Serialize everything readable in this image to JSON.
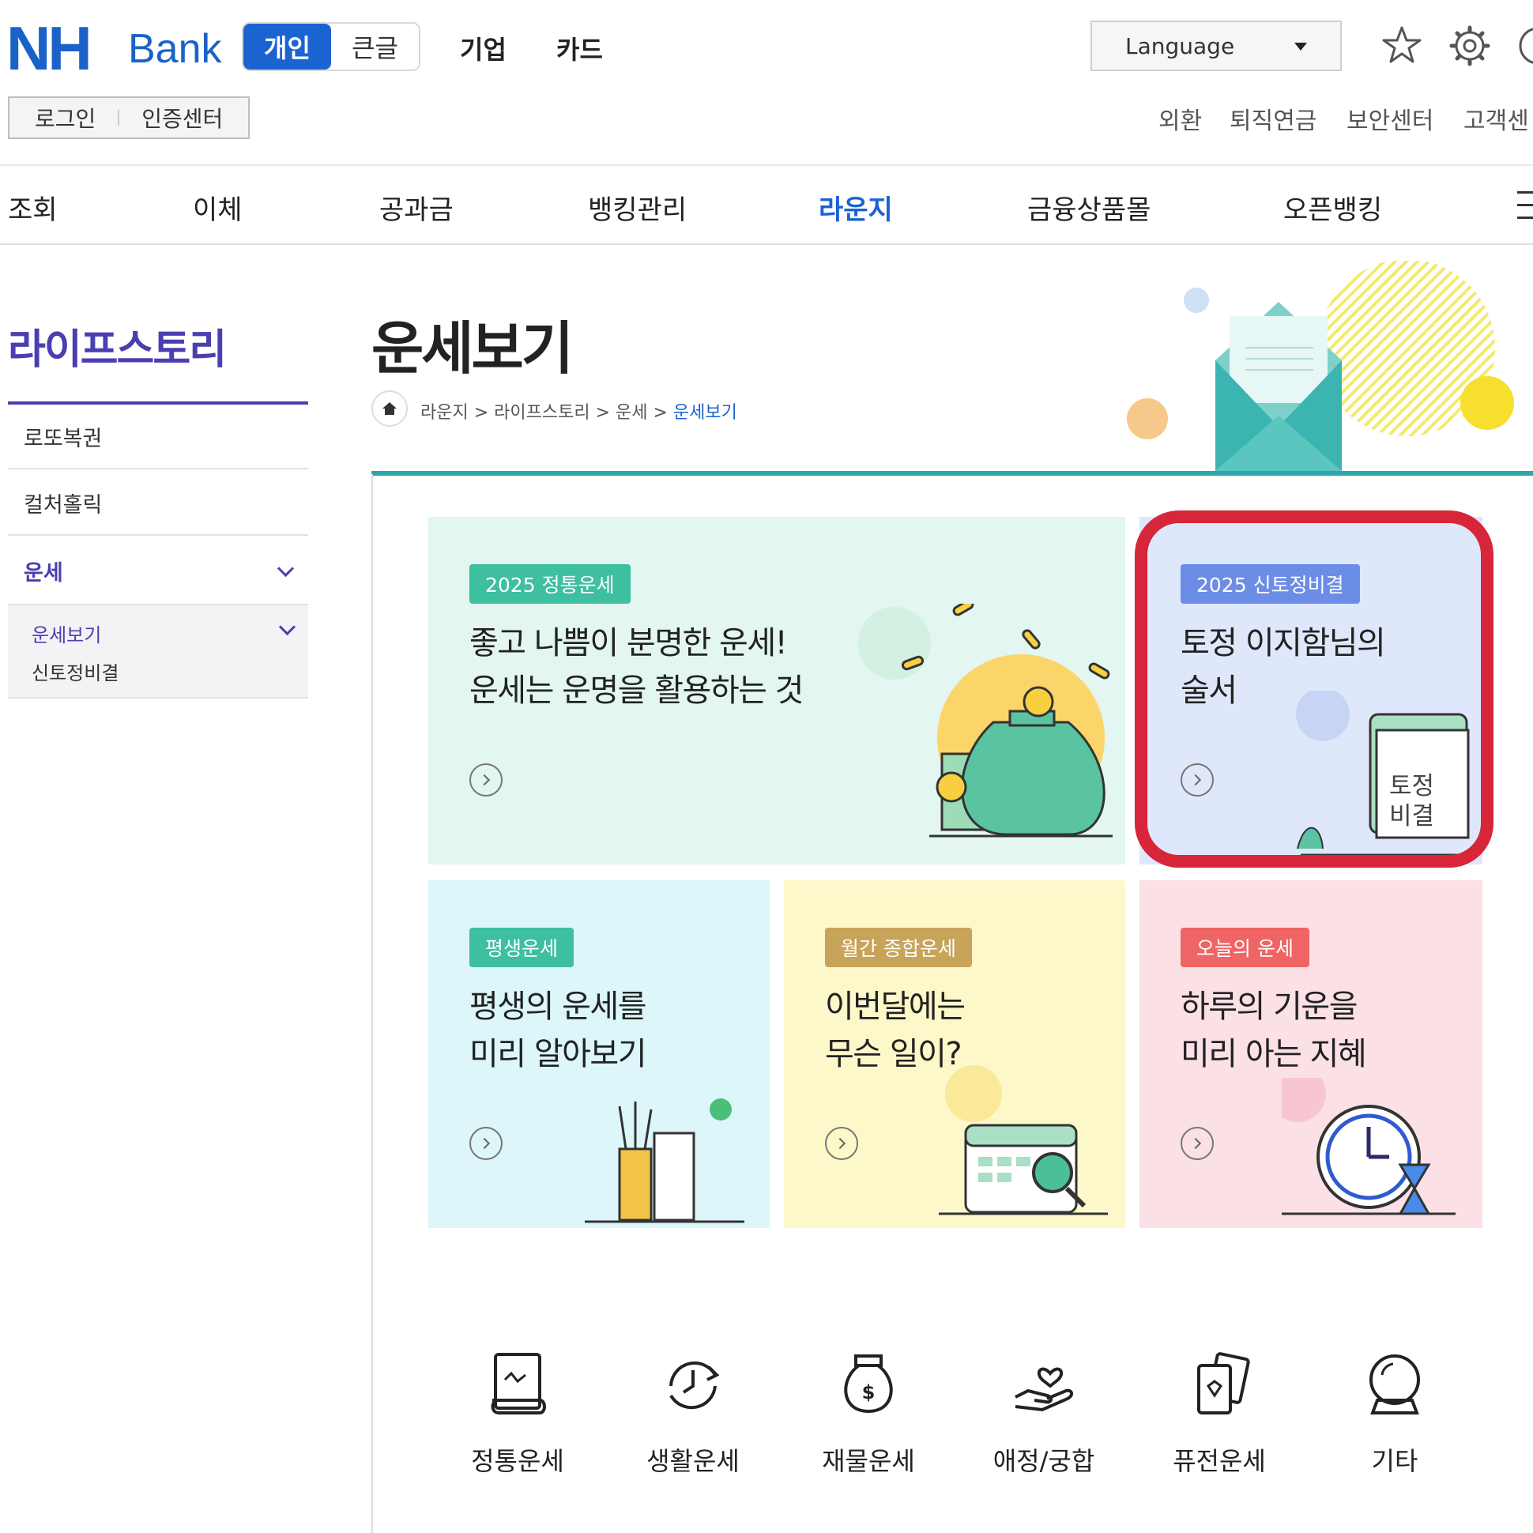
{
  "header": {
    "logo_nh": "NH",
    "logo_bank": "Bank",
    "toggle": {
      "personal": "개인",
      "large_text": "큰글"
    },
    "top_links": [
      "기업",
      "카드"
    ],
    "language": "Language",
    "login": "로그인",
    "auth_center": "인증센터",
    "utility_links": [
      "외환",
      "퇴직연금",
      "보안센터",
      "고객센"
    ]
  },
  "main_nav": [
    "조회",
    "이체",
    "공과금",
    "뱅킹관리",
    "라운지",
    "금융상품몰",
    "오픈뱅킹"
  ],
  "sidebar": {
    "title": "라이프스토리",
    "items": [
      "로또복권",
      "컬처홀릭",
      "운세"
    ],
    "sub_items": [
      "운세보기",
      "신토정비결"
    ]
  },
  "page": {
    "title": "운세보기",
    "breadcrumb": {
      "part1": "라운지 > 라이프스토리 > 운세 > ",
      "current": "운세보기"
    }
  },
  "cards": [
    {
      "tag": "2025 정통운세",
      "line1": "좋고 나쁨이 분명한 운세!",
      "line2": "운세는 운명을 활용하는 것",
      "tag_color": "#3dbfa0",
      "bg": "#e3f6f1"
    },
    {
      "tag": "2025 신토정비결",
      "line1": "토정 이지함님의",
      "line2": "술서",
      "tag_color": "#6b8de6",
      "bg": "#dfe7fb",
      "book_line1": "토정",
      "book_line2": "비결"
    },
    {
      "tag": "평생운세",
      "line1": "평생의 운세를",
      "line2": "미리 알아보기",
      "tag_color": "#3dbfa0",
      "bg": "#dcf6f9"
    },
    {
      "tag": "월간 종합운세",
      "line1": "이번달에는",
      "line2": "무슨 일이?",
      "tag_color": "#c8a35a",
      "bg": "#fdf8c9"
    },
    {
      "tag": "오늘의 운세",
      "line1": "하루의 기운을",
      "line2": "미리 아는 지혜",
      "tag_color": "#ef6565",
      "bg": "#fbe0e6"
    }
  ],
  "bottom_icons": [
    {
      "label": "정통운세",
      "icon": "scroll-icon"
    },
    {
      "label": "생활운세",
      "icon": "clock-refresh-icon"
    },
    {
      "label": "재물운세",
      "icon": "money-bag-icon"
    },
    {
      "label": "애정/궁합",
      "icon": "heart-hand-icon"
    },
    {
      "label": "퓨전운세",
      "icon": "cards-icon"
    },
    {
      "label": "기타",
      "icon": "crystal-ball-icon"
    }
  ],
  "colors": {
    "brand_blue": "#1b63d1",
    "purple": "#4a3fb0",
    "teal": "#2ba5a7",
    "highlight_red": "#d7253a"
  }
}
